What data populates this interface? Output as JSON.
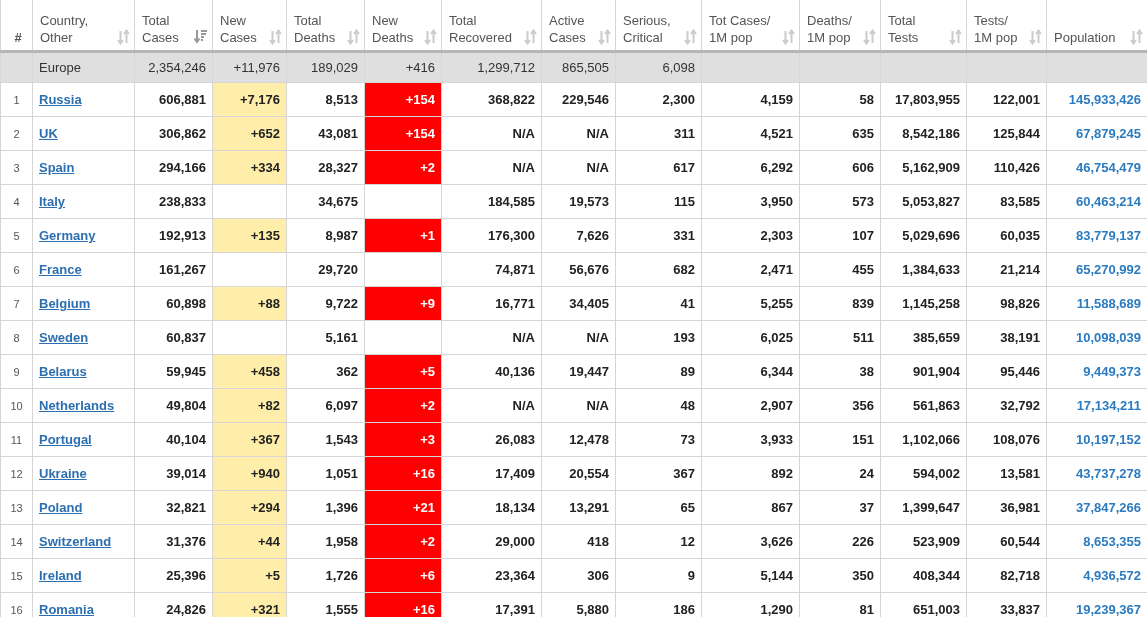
{
  "table": {
    "columns": [
      {
        "label": "#",
        "sortable": false
      },
      {
        "label": "Country, Other",
        "sortable": true,
        "sorted": false
      },
      {
        "label": "Total Cases",
        "sortable": true,
        "sorted": true
      },
      {
        "label": "New Cases",
        "sortable": true,
        "sorted": false
      },
      {
        "label": "Total Deaths",
        "sortable": true,
        "sorted": false
      },
      {
        "label": "New Deaths",
        "sortable": true,
        "sorted": false
      },
      {
        "label": "Total Recovered",
        "sortable": true,
        "sorted": false
      },
      {
        "label": "Active Cases",
        "sortable": true,
        "sorted": false
      },
      {
        "label": "Serious, Critical",
        "sortable": true,
        "sorted": false
      },
      {
        "label": "Tot Cases/ 1M pop",
        "sortable": true,
        "sorted": false
      },
      {
        "label": "Deaths/ 1M pop",
        "sortable": true,
        "sorted": false
      },
      {
        "label": "Total Tests",
        "sortable": true,
        "sorted": false
      },
      {
        "label": "Tests/ 1M pop",
        "sortable": true,
        "sorted": false
      },
      {
        "label": "Population",
        "sortable": true,
        "sorted": false
      }
    ],
    "total_row": {
      "country": "Europe",
      "total_cases": "2,354,246",
      "new_cases": "+11,976",
      "total_deaths": "189,029",
      "new_deaths": "+416",
      "total_recovered": "1,299,712",
      "active_cases": "865,505",
      "serious_critical": "6,098"
    },
    "rows": [
      {
        "index": "1",
        "country": "Russia",
        "total_cases": "606,881",
        "new_cases": "+7,176",
        "total_deaths": "8,513",
        "new_deaths": "+154",
        "total_recovered": "368,822",
        "active_cases": "229,546",
        "serious_critical": "2,300",
        "tot_cases_per_1m": "4,159",
        "deaths_per_1m": "58",
        "total_tests": "17,803,955",
        "tests_per_1m": "122,001",
        "population": "145,933,426"
      },
      {
        "index": "2",
        "country": "UK",
        "total_cases": "306,862",
        "new_cases": "+652",
        "total_deaths": "43,081",
        "new_deaths": "+154",
        "total_recovered": "N/A",
        "active_cases": "N/A",
        "serious_critical": "311",
        "tot_cases_per_1m": "4,521",
        "deaths_per_1m": "635",
        "total_tests": "8,542,186",
        "tests_per_1m": "125,844",
        "population": "67,879,245"
      },
      {
        "index": "3",
        "country": "Spain",
        "total_cases": "294,166",
        "new_cases": "+334",
        "total_deaths": "28,327",
        "new_deaths": "+2",
        "total_recovered": "N/A",
        "active_cases": "N/A",
        "serious_critical": "617",
        "tot_cases_per_1m": "6,292",
        "deaths_per_1m": "606",
        "total_tests": "5,162,909",
        "tests_per_1m": "110,426",
        "population": "46,754,479"
      },
      {
        "index": "4",
        "country": "Italy",
        "total_cases": "238,833",
        "total_deaths": "34,675",
        "total_recovered": "184,585",
        "active_cases": "19,573",
        "serious_critical": "115",
        "tot_cases_per_1m": "3,950",
        "deaths_per_1m": "573",
        "total_tests": "5,053,827",
        "tests_per_1m": "83,585",
        "population": "60,463,214"
      },
      {
        "index": "5",
        "country": "Germany",
        "total_cases": "192,913",
        "new_cases": "+135",
        "total_deaths": "8,987",
        "new_deaths": "+1",
        "total_recovered": "176,300",
        "active_cases": "7,626",
        "serious_critical": "331",
        "tot_cases_per_1m": "2,303",
        "deaths_per_1m": "107",
        "total_tests": "5,029,696",
        "tests_per_1m": "60,035",
        "population": "83,779,137"
      },
      {
        "index": "6",
        "country": "France",
        "total_cases": "161,267",
        "total_deaths": "29,720",
        "total_recovered": "74,871",
        "active_cases": "56,676",
        "serious_critical": "682",
        "tot_cases_per_1m": "2,471",
        "deaths_per_1m": "455",
        "total_tests": "1,384,633",
        "tests_per_1m": "21,214",
        "population": "65,270,992"
      },
      {
        "index": "7",
        "country": "Belgium",
        "total_cases": "60,898",
        "new_cases": "+88",
        "total_deaths": "9,722",
        "new_deaths": "+9",
        "total_recovered": "16,771",
        "active_cases": "34,405",
        "serious_critical": "41",
        "tot_cases_per_1m": "5,255",
        "deaths_per_1m": "839",
        "total_tests": "1,145,258",
        "tests_per_1m": "98,826",
        "population": "11,588,689"
      },
      {
        "index": "8",
        "country": "Sweden",
        "total_cases": "60,837",
        "total_deaths": "5,161",
        "total_recovered": "N/A",
        "active_cases": "N/A",
        "serious_critical": "193",
        "tot_cases_per_1m": "6,025",
        "deaths_per_1m": "511",
        "total_tests": "385,659",
        "tests_per_1m": "38,191",
        "population": "10,098,039"
      },
      {
        "index": "9",
        "country": "Belarus",
        "total_cases": "59,945",
        "new_cases": "+458",
        "total_deaths": "362",
        "new_deaths": "+5",
        "total_recovered": "40,136",
        "active_cases": "19,447",
        "serious_critical": "89",
        "tot_cases_per_1m": "6,344",
        "deaths_per_1m": "38",
        "total_tests": "901,904",
        "tests_per_1m": "95,446",
        "population": "9,449,373"
      },
      {
        "index": "10",
        "country": "Netherlands",
        "total_cases": "49,804",
        "new_cases": "+82",
        "total_deaths": "6,097",
        "new_deaths": "+2",
        "total_recovered": "N/A",
        "active_cases": "N/A",
        "serious_critical": "48",
        "tot_cases_per_1m": "2,907",
        "deaths_per_1m": "356",
        "total_tests": "561,863",
        "tests_per_1m": "32,792",
        "population": "17,134,211"
      },
      {
        "index": "11",
        "country": "Portugal",
        "total_cases": "40,104",
        "new_cases": "+367",
        "total_deaths": "1,543",
        "new_deaths": "+3",
        "total_recovered": "26,083",
        "active_cases": "12,478",
        "serious_critical": "73",
        "tot_cases_per_1m": "3,933",
        "deaths_per_1m": "151",
        "total_tests": "1,102,066",
        "tests_per_1m": "108,076",
        "population": "10,197,152"
      },
      {
        "index": "12",
        "country": "Ukraine",
        "total_cases": "39,014",
        "new_cases": "+940",
        "total_deaths": "1,051",
        "new_deaths": "+16",
        "total_recovered": "17,409",
        "active_cases": "20,554",
        "serious_critical": "367",
        "tot_cases_per_1m": "892",
        "deaths_per_1m": "24",
        "total_tests": "594,002",
        "tests_per_1m": "13,581",
        "population": "43,737,278"
      },
      {
        "index": "13",
        "country": "Poland",
        "total_cases": "32,821",
        "new_cases": "+294",
        "total_deaths": "1,396",
        "new_deaths": "+21",
        "total_recovered": "18,134",
        "active_cases": "13,291",
        "serious_critical": "65",
        "tot_cases_per_1m": "867",
        "deaths_per_1m": "37",
        "total_tests": "1,399,647",
        "tests_per_1m": "36,981",
        "population": "37,847,266"
      },
      {
        "index": "14",
        "country": "Switzerland",
        "total_cases": "31,376",
        "new_cases": "+44",
        "total_deaths": "1,958",
        "new_deaths": "+2",
        "total_recovered": "29,000",
        "active_cases": "418",
        "serious_critical": "12",
        "tot_cases_per_1m": "3,626",
        "deaths_per_1m": "226",
        "total_tests": "523,909",
        "tests_per_1m": "60,544",
        "population": "8,653,355"
      },
      {
        "index": "15",
        "country": "Ireland",
        "total_cases": "25,396",
        "new_cases": "+5",
        "total_deaths": "1,726",
        "new_deaths": "+6",
        "total_recovered": "23,364",
        "active_cases": "306",
        "serious_critical": "9",
        "tot_cases_per_1m": "5,144",
        "deaths_per_1m": "350",
        "total_tests": "408,344",
        "tests_per_1m": "82,718",
        "population": "4,936,572"
      },
      {
        "index": "16",
        "country": "Romania",
        "total_cases": "24,826",
        "new_cases": "+321",
        "total_deaths": "1,555",
        "new_deaths": "+16",
        "total_recovered": "17,391",
        "active_cases": "5,880",
        "serious_critical": "186",
        "tot_cases_per_1m": "1,290",
        "deaths_per_1m": "81",
        "total_tests": "651,003",
        "tests_per_1m": "33,837",
        "population": "19,239,367"
      }
    ]
  }
}
